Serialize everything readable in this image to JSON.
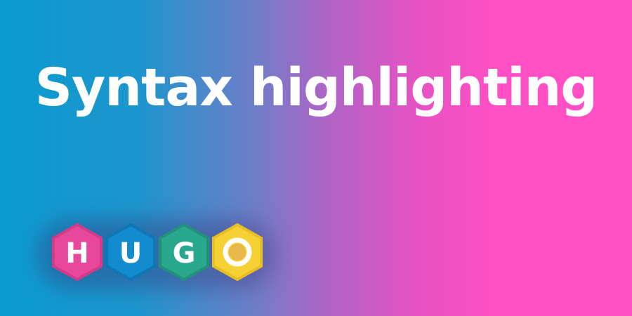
{
  "banner": {
    "title": "Syntax highlighting",
    "logo": {
      "letters": [
        "H",
        "U",
        "G",
        "O"
      ],
      "colors": {
        "h": "#e9479b",
        "u": "#138bcf",
        "g": "#2aa88d",
        "o": "#f6d133",
        "o_ring": "#e8b84a"
      }
    }
  }
}
